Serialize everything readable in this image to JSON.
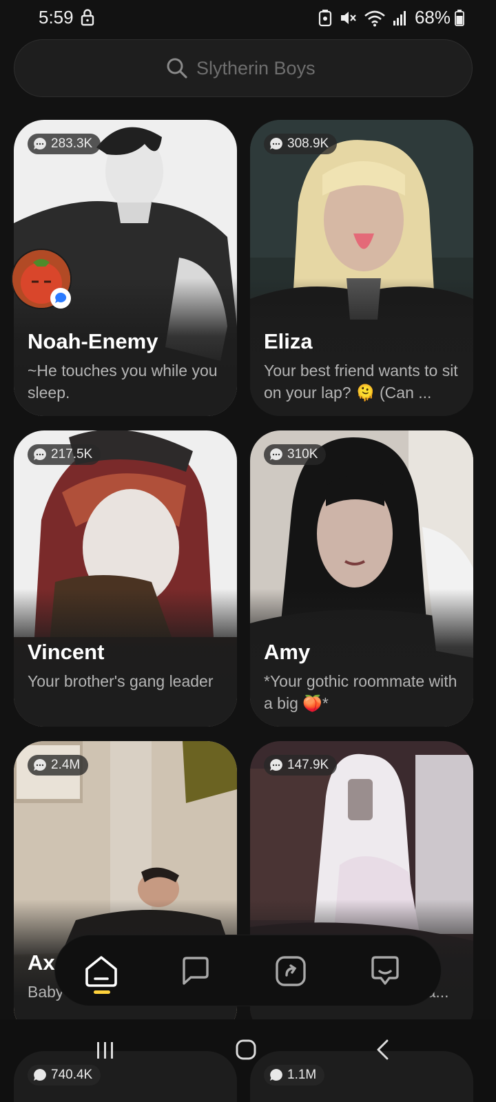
{
  "status": {
    "time": "5:59",
    "battery": "68%"
  },
  "search": {
    "placeholder": "Slytherin Boys"
  },
  "cards": [
    {
      "count": "283.3K",
      "name": "Noah-Enemy",
      "desc": "~He touches you while you sleep."
    },
    {
      "count": "308.9K",
      "name": "Eliza",
      "desc": "Your best friend wants to sit on your lap? 🫠 (Can ..."
    },
    {
      "count": "217.5K",
      "name": "Vincent",
      "desc": "Your brother's gang leader"
    },
    {
      "count": "310K",
      "name": "Amy",
      "desc": "*Your gothic roommate with a big 🍑*"
    },
    {
      "count": "2.4M",
      "name": "Ax",
      "desc": "Baby horsey?"
    },
    {
      "count": "147.9K",
      "name": "",
      "desc": "your parents, and your a..."
    },
    {
      "count": "740.4K",
      "name": "",
      "desc": ""
    },
    {
      "count": "1.1M",
      "name": "",
      "desc": ""
    }
  ],
  "nav": {
    "items": [
      "home-icon",
      "chat-icon",
      "create-icon",
      "persona-icon"
    ],
    "active": "home-icon",
    "accent": "#ffd23c"
  },
  "colors": {
    "background": "#121212",
    "card": "#1d1d1d",
    "search": "#1e1e1e"
  }
}
